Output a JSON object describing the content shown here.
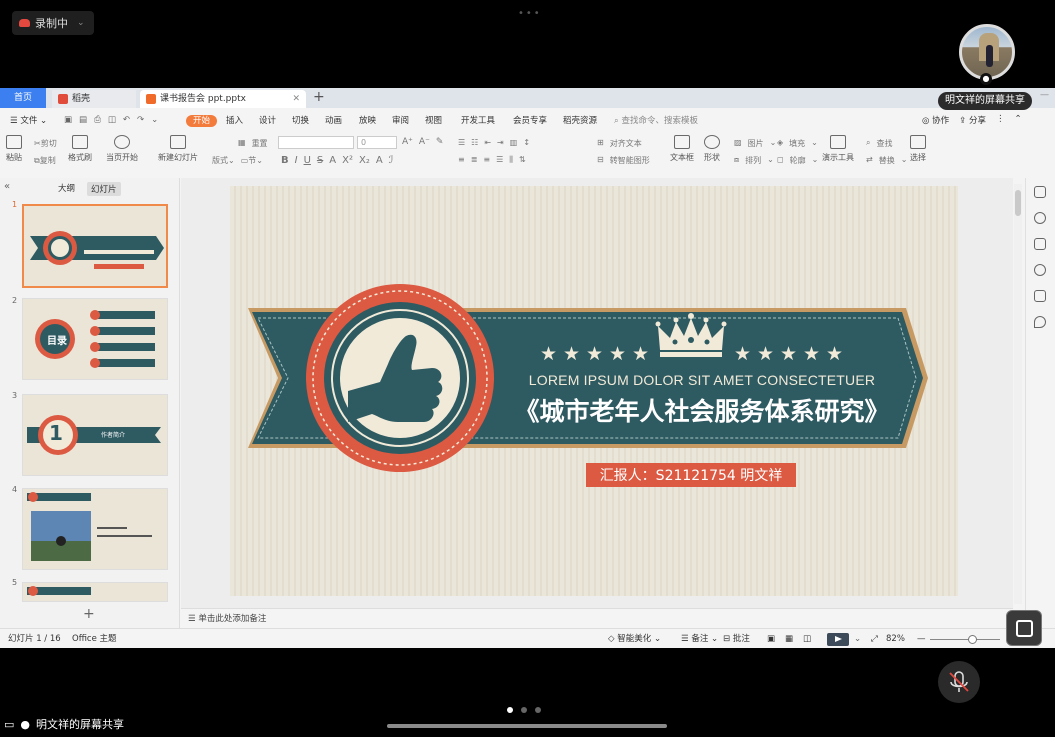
{
  "meeting": {
    "recording_label": "录制中",
    "share_name_tag": "明文祥的屏幕共享",
    "share_label_bottom": "明文祥的屏幕共享",
    "page_dot_count": 3
  },
  "app": {
    "tabs": {
      "home": "首页",
      "daoke": "稻壳",
      "file": "课书报告会 ppt.pptx"
    },
    "menu": {
      "file": "文件",
      "items": [
        "开始",
        "插入",
        "设计",
        "切换",
        "动画",
        "放映",
        "审阅",
        "视图",
        "开发工具",
        "会员专享",
        "稻壳资源"
      ],
      "active": "开始",
      "search_placeholder": "查找命令、搜索模板",
      "collab": "协作",
      "share": "分享"
    },
    "ribbon": {
      "paste": "粘贴",
      "cut": "剪切",
      "copy": "复制",
      "format_painter": "格式刷",
      "from_current": "当页开始",
      "new_slide": "新建幻灯片",
      "layout": "版式",
      "section": "节",
      "reset": "重置",
      "font_size": "0",
      "textbox": "文本框",
      "shape": "形状",
      "picture": "图片",
      "arrange": "排列",
      "fill": "填充",
      "outline": "轮廓",
      "present_tools": "演示工具",
      "find": "查找",
      "replace": "替换",
      "select": "选择",
      "align_text": "对齐文本",
      "convert_smartart": "转智能图形"
    },
    "left_panel": {
      "tab_outline": "大纲",
      "tab_slides": "幻灯片",
      "slide_numbers": [
        "1",
        "2",
        "3",
        "4",
        "5"
      ],
      "thumb2_title": "目录",
      "thumb3_number": "1",
      "thumb3_label": "作者简介"
    },
    "slide": {
      "subtitle_en": "LOREM IPSUM DOLOR SIT AMET CONSECTETUER",
      "title": "《城市老年人社会服务体系研究》",
      "presenter": "汇报人：S21121754 明文祥"
    },
    "notes_placeholder": "单击此处添加备注",
    "status": {
      "slide_counter": "幻灯片 1 / 16",
      "theme": "Office 主题",
      "smart_beautify": "智能美化",
      "notes": "备注",
      "comments": "批注",
      "zoom": "82%"
    }
  },
  "colors": {
    "banner_teal": "#2e5a62",
    "accent_red": "#dc5a42",
    "cream": "#f1ead8",
    "wps_orange": "#f37b3c"
  }
}
